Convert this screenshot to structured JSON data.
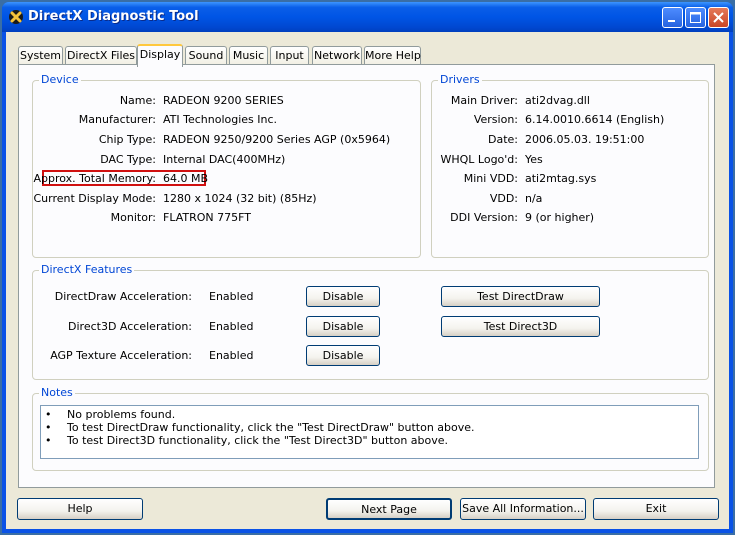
{
  "window": {
    "title": "DirectX Diagnostic Tool"
  },
  "tabs": [
    "System",
    "DirectX Files",
    "Display",
    "Sound",
    "Music",
    "Input",
    "Network",
    "More Help"
  ],
  "active_tab": "Display",
  "device": {
    "label": "Device",
    "rows": [
      {
        "label": "Name:",
        "value": "RADEON 9200 SERIES"
      },
      {
        "label": "Manufacturer:",
        "value": "ATI Technologies Inc."
      },
      {
        "label": "Chip Type:",
        "value": "RADEON 9250/9200 Series AGP (0x5964)"
      },
      {
        "label": "DAC Type:",
        "value": "Internal DAC(400MHz)"
      },
      {
        "label": "Approx. Total Memory:",
        "value": "64.0 MB"
      },
      {
        "label": "Current Display Mode:",
        "value": "1280 x 1024 (32 bit) (85Hz)"
      },
      {
        "label": "Monitor:",
        "value": "FLATRON 775FT"
      }
    ]
  },
  "drivers": {
    "label": "Drivers",
    "rows": [
      {
        "label": "Main Driver:",
        "value": "ati2dvag.dll"
      },
      {
        "label": "Version:",
        "value": "6.14.0010.6614 (English)"
      },
      {
        "label": "Date:",
        "value": "2006.05.03. 19:51:00"
      },
      {
        "label": "WHQL Logo'd:",
        "value": "Yes"
      },
      {
        "label": "Mini VDD:",
        "value": "ati2mtag.sys"
      },
      {
        "label": "VDD:",
        "value": "n/a"
      },
      {
        "label": "DDI Version:",
        "value": "9 (or higher)"
      }
    ]
  },
  "features": {
    "label": "DirectX Features",
    "rows": [
      {
        "label": "DirectDraw Acceleration:",
        "value": "Enabled",
        "button": "Disable",
        "test": "Test DirectDraw"
      },
      {
        "label": "Direct3D Acceleration:",
        "value": "Enabled",
        "button": "Disable",
        "test": "Test Direct3D"
      },
      {
        "label": "AGP Texture Acceleration:",
        "value": "Enabled",
        "button": "Disable"
      }
    ]
  },
  "notes": {
    "label": "Notes",
    "bullet": "•",
    "items": [
      "No problems found.",
      "To test DirectDraw functionality, click the \"Test DirectDraw\" button above.",
      "To test Direct3D functionality, click the \"Test Direct3D\" button above."
    ]
  },
  "footer": {
    "help": "Help",
    "next": "Next Page",
    "save": "Save All Information...",
    "exit": "Exit"
  },
  "highlight_color": "#d01010"
}
